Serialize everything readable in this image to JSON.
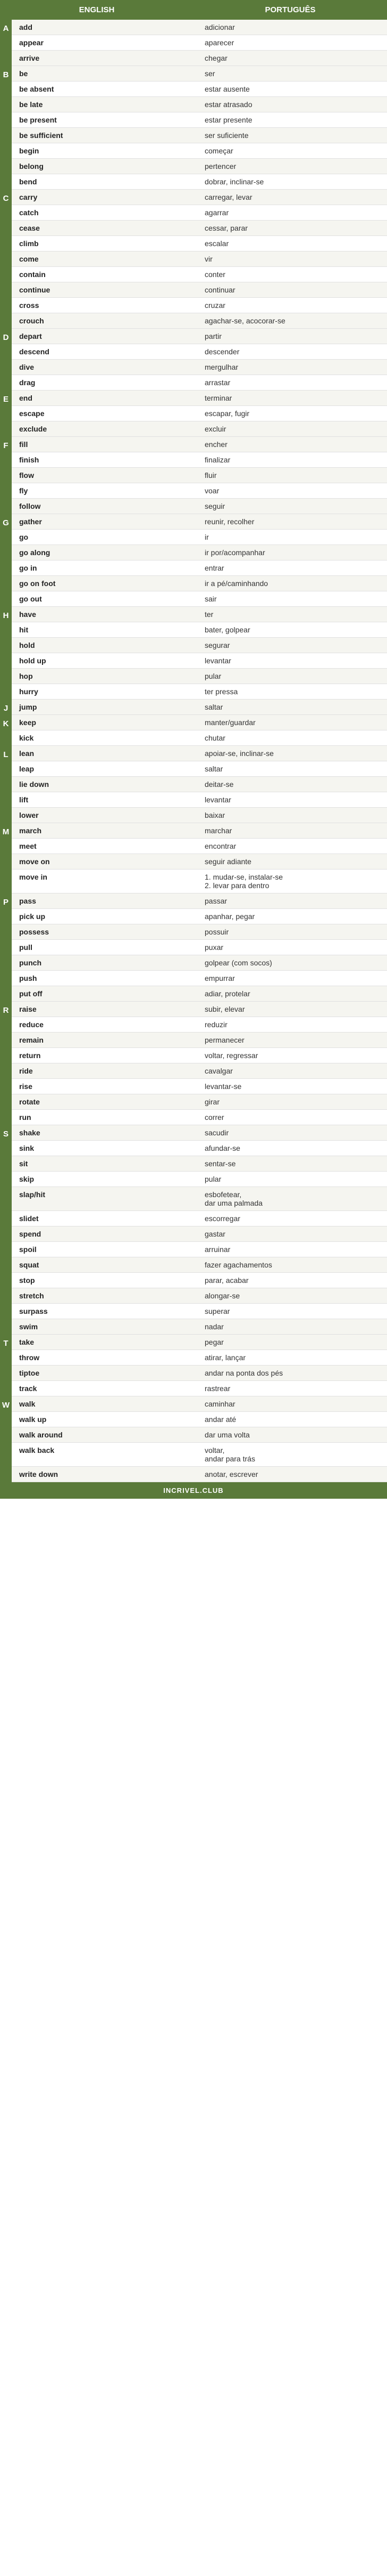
{
  "header": {
    "col_en": "ENGLISH",
    "col_pt": "PORTUGUÊS"
  },
  "footer": {
    "label": "INCRIVEL.CLUB"
  },
  "sections": [
    {
      "letter": "A",
      "rows": [
        {
          "en": "add",
          "pt": "adicionar"
        },
        {
          "en": "appear",
          "pt": "aparecer"
        },
        {
          "en": "arrive",
          "pt": "chegar"
        }
      ]
    },
    {
      "letter": "B",
      "rows": [
        {
          "en": "be",
          "pt": "ser"
        },
        {
          "en": "be absent",
          "pt": "estar ausente"
        },
        {
          "en": "be late",
          "pt": "estar atrasado"
        },
        {
          "en": "be present",
          "pt": "estar presente"
        },
        {
          "en": "be sufficient",
          "pt": "ser suficiente"
        },
        {
          "en": "begin",
          "pt": "começar"
        },
        {
          "en": "belong",
          "pt": "pertencer"
        },
        {
          "en": "bend",
          "pt": "dobrar, inclinar-se"
        }
      ]
    },
    {
      "letter": "C",
      "rows": [
        {
          "en": "carry",
          "pt": "carregar, levar"
        },
        {
          "en": "catch",
          "pt": "agarrar"
        },
        {
          "en": "cease",
          "pt": "cessar, parar"
        },
        {
          "en": "climb",
          "pt": "escalar"
        },
        {
          "en": "come",
          "pt": "vir"
        },
        {
          "en": "contain",
          "pt": "conter"
        },
        {
          "en": "continue",
          "pt": "continuar"
        },
        {
          "en": "cross",
          "pt": "cruzar"
        },
        {
          "en": "crouch",
          "pt": "agachar-se, acocorar-se"
        }
      ]
    },
    {
      "letter": "D",
      "rows": [
        {
          "en": "depart",
          "pt": "partir"
        },
        {
          "en": "descend",
          "pt": "descender"
        },
        {
          "en": "dive",
          "pt": "mergulhar"
        },
        {
          "en": "drag",
          "pt": "arrastar"
        }
      ]
    },
    {
      "letter": "E",
      "rows": [
        {
          "en": "end",
          "pt": "terminar"
        },
        {
          "en": "escape",
          "pt": "escapar, fugir"
        },
        {
          "en": "exclude",
          "pt": "excluir"
        }
      ]
    },
    {
      "letter": "F",
      "rows": [
        {
          "en": "fill",
          "pt": "encher"
        },
        {
          "en": "finish",
          "pt": "finalizar"
        },
        {
          "en": "flow",
          "pt": "fluir"
        },
        {
          "en": "fly",
          "pt": "voar"
        },
        {
          "en": "follow",
          "pt": "seguir"
        }
      ]
    },
    {
      "letter": "G",
      "rows": [
        {
          "en": "gather",
          "pt": "reunir, recolher"
        },
        {
          "en": "go",
          "pt": "ir"
        },
        {
          "en": "go along",
          "pt": "ir por/acompanhar"
        },
        {
          "en": "go in",
          "pt": "entrar"
        },
        {
          "en": "go on foot",
          "pt": "ir a pé/caminhando"
        },
        {
          "en": "go out",
          "pt": "sair"
        }
      ]
    },
    {
      "letter": "H",
      "rows": [
        {
          "en": "have",
          "pt": "ter"
        },
        {
          "en": "hit",
          "pt": "bater, golpear"
        },
        {
          "en": "hold",
          "pt": "segurar"
        },
        {
          "en": "hold up",
          "pt": "levantar"
        },
        {
          "en": "hop",
          "pt": "pular"
        },
        {
          "en": "hurry",
          "pt": "ter pressa"
        }
      ]
    },
    {
      "letter": "J",
      "rows": [
        {
          "en": "jump",
          "pt": "saltar"
        }
      ]
    },
    {
      "letter": "K",
      "rows": [
        {
          "en": "keep",
          "pt": "manter/guardar"
        },
        {
          "en": "kick",
          "pt": "chutar"
        }
      ]
    },
    {
      "letter": "L",
      "rows": [
        {
          "en": "lean",
          "pt": "apoiar-se, inclinar-se"
        },
        {
          "en": "leap",
          "pt": "saltar"
        },
        {
          "en": "lie down",
          "pt": "deitar-se"
        },
        {
          "en": "lift",
          "pt": "levantar"
        },
        {
          "en": "lower",
          "pt": "baixar"
        }
      ]
    },
    {
      "letter": "M",
      "rows": [
        {
          "en": "march",
          "pt": "marchar"
        },
        {
          "en": "meet",
          "pt": "encontrar"
        },
        {
          "en": "move on",
          "pt": "seguir adiante"
        },
        {
          "en": "move in",
          "pt": "1. mudar-se, instalar-se\n2. levar para dentro"
        }
      ]
    },
    {
      "letter": "P",
      "rows": [
        {
          "en": "pass",
          "pt": "passar"
        },
        {
          "en": "pick up",
          "pt": "apanhar, pegar"
        },
        {
          "en": "possess",
          "pt": "possuir"
        },
        {
          "en": "pull",
          "pt": "puxar"
        },
        {
          "en": "punch",
          "pt": "golpear (com socos)"
        },
        {
          "en": "push",
          "pt": "empurrar"
        },
        {
          "en": "put off",
          "pt": "adiar, protelar"
        }
      ]
    },
    {
      "letter": "R",
      "rows": [
        {
          "en": "raise",
          "pt": "subir, elevar"
        },
        {
          "en": "reduce",
          "pt": "reduzir"
        },
        {
          "en": "remain",
          "pt": "permanecer"
        },
        {
          "en": "return",
          "pt": "voltar, regressar"
        },
        {
          "en": "ride",
          "pt": "cavalgar"
        },
        {
          "en": "rise",
          "pt": "levantar-se"
        },
        {
          "en": "rotate",
          "pt": "girar"
        },
        {
          "en": "run",
          "pt": "correr"
        }
      ]
    },
    {
      "letter": "S",
      "rows": [
        {
          "en": "shake",
          "pt": "sacudir"
        },
        {
          "en": "sink",
          "pt": "afundar-se"
        },
        {
          "en": "sit",
          "pt": "sentar-se"
        },
        {
          "en": "skip",
          "pt": "pular"
        },
        {
          "en": "slap/hit",
          "pt": "esbofetear,\ndar uma palmada"
        },
        {
          "en": "slidet",
          "pt": "escorregar"
        },
        {
          "en": "spend",
          "pt": "gastar"
        },
        {
          "en": "spoil",
          "pt": "arruinar"
        },
        {
          "en": "squat",
          "pt": "fazer agachamentos"
        },
        {
          "en": "stop",
          "pt": "parar, acabar"
        },
        {
          "en": "stretch",
          "pt": "alongar-se"
        },
        {
          "en": "surpass",
          "pt": "superar"
        },
        {
          "en": "swim",
          "pt": "nadar"
        }
      ]
    },
    {
      "letter": "T",
      "rows": [
        {
          "en": "take",
          "pt": "pegar"
        },
        {
          "en": "throw",
          "pt": "atirar, lançar"
        },
        {
          "en": "tiptoe",
          "pt": "andar na ponta dos pés"
        },
        {
          "en": "track",
          "pt": "rastrear"
        }
      ]
    },
    {
      "letter": "W",
      "rows": [
        {
          "en": "walk",
          "pt": "caminhar"
        },
        {
          "en": "walk up",
          "pt": "andar até"
        },
        {
          "en": "walk around",
          "pt": "dar uma volta"
        },
        {
          "en": "walk back",
          "pt": "voltar,\nandar para trás"
        },
        {
          "en": "write down",
          "pt": "anotar, escrever"
        }
      ]
    }
  ]
}
